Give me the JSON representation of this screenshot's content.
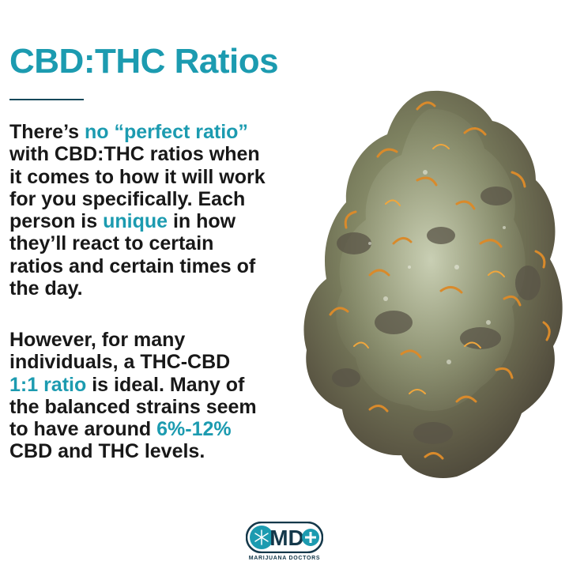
{
  "title": "CBD:THC Ratios",
  "paragraph1": [
    [
      {
        "t": "There’s "
      },
      {
        "t": "no “perfect ratio”",
        "hl": true
      }
    ],
    [
      {
        "t": "with CBD:THC ratios when"
      }
    ],
    [
      {
        "t": "it comes to how it will work"
      }
    ],
    [
      {
        "t": "for you specifically. Each"
      }
    ],
    [
      {
        "t": "person is "
      },
      {
        "t": "unique",
        "hl": true
      },
      {
        "t": " in how"
      }
    ],
    [
      {
        "t": "they’ll react to certain"
      }
    ],
    [
      {
        "t": "ratios and certain times of"
      }
    ],
    [
      {
        "t": "the day."
      }
    ]
  ],
  "paragraph2": [
    [
      {
        "t": "However, for many"
      }
    ],
    [
      {
        "t": "individuals, a THC-CBD"
      }
    ],
    [
      {
        "t": "1:1 ratio",
        "hl": true
      },
      {
        "t": " is ideal. Many of"
      }
    ],
    [
      {
        "t": "the balanced strains seem"
      }
    ],
    [
      {
        "t": "to have around "
      },
      {
        "t": "6%-12%",
        "hl": true
      }
    ],
    [
      {
        "t": "CBD and THC levels."
      }
    ]
  ],
  "logo": {
    "letters": "MD",
    "name": "MARIJUANA DOCTORS"
  },
  "colors": {
    "accent": "#1c9bb0",
    "text": "#181818",
    "rule": "#16485a",
    "logo_dark": "#14384a"
  },
  "image": {
    "subject": "cannabis-bud"
  }
}
